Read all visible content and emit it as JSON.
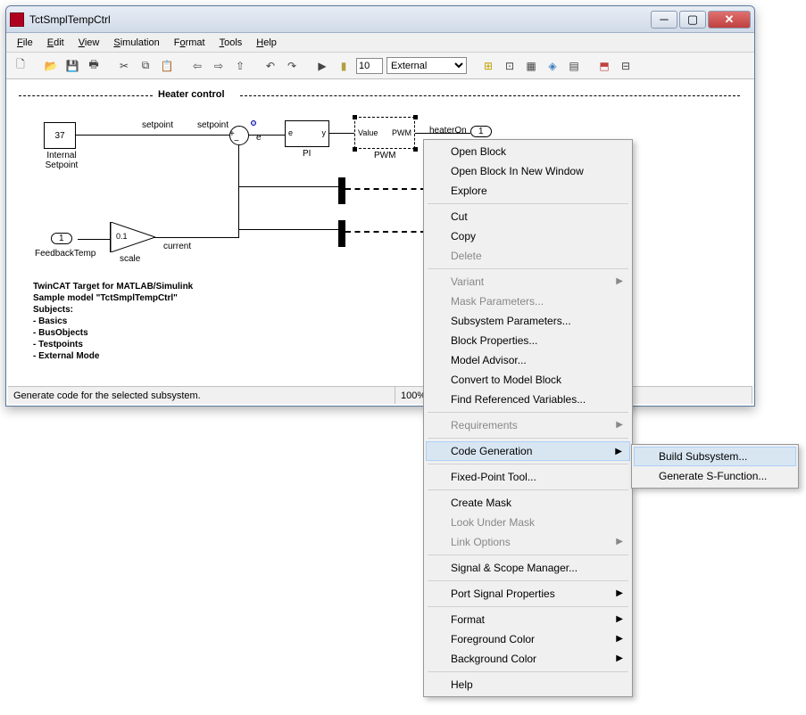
{
  "window": {
    "title": "TctSmplTempCtrl"
  },
  "menu": {
    "file": "File",
    "edit": "Edit",
    "view": "View",
    "simulation": "Simulation",
    "format": "Format",
    "tools": "Tools",
    "help": "Help"
  },
  "toolbar": {
    "time": "10",
    "mode": "External"
  },
  "diagram": {
    "section": "Heater control",
    "setpoint_block": "37",
    "setpoint_name": "Internal\nSetpoint",
    "sp_label1": "setpoint",
    "sp_label2": "setpoint",
    "sum_e": "e",
    "pi_in": "e",
    "pi_out": "y",
    "pi_name": "PI",
    "pwm_in": "Value",
    "pwm_out": "PWM",
    "pwm_name": "PWM",
    "heaterOn": "heaterOn",
    "out1": "1",
    "in1": "1",
    "fb_name": "FeedbackTemp",
    "gain": "0.1",
    "gain_name": "scale",
    "current": "current"
  },
  "notes": {
    "l1": "TwinCAT Target for MATLAB/Simulink",
    "l2": "Sample model \"TctSmplTempCtrl\"",
    "l3": "Subjects:",
    "l4": "- Basics",
    "l5": "- BusObjects",
    "l6": "- Testpoints",
    "l7": "- External Mode"
  },
  "status": {
    "msg": "Generate code for the selected subsystem.",
    "zoom": "100%"
  },
  "ctx": {
    "open": "Open Block",
    "openw": "Open Block In New Window",
    "explore": "Explore",
    "cut": "Cut",
    "copy": "Copy",
    "delete": "Delete",
    "variant": "Variant",
    "mask": "Mask Parameters...",
    "subp": "Subsystem Parameters...",
    "blockp": "Block Properties...",
    "adv": "Model Advisor...",
    "conv": "Convert to Model Block",
    "findref": "Find Referenced Variables...",
    "req": "Requirements",
    "codegen": "Code Generation",
    "fixpt": "Fixed-Point Tool...",
    "cmask": "Create Mask",
    "lookmask": "Look Under Mask",
    "linkopt": "Link Options",
    "sigscope": "Signal & Scope Manager...",
    "portsig": "Port Signal Properties",
    "format": "Format",
    "fg": "Foreground Color",
    "bg": "Background Color",
    "help": "Help"
  },
  "sub": {
    "build": "Build Subsystem...",
    "gensf": "Generate S-Function..."
  }
}
